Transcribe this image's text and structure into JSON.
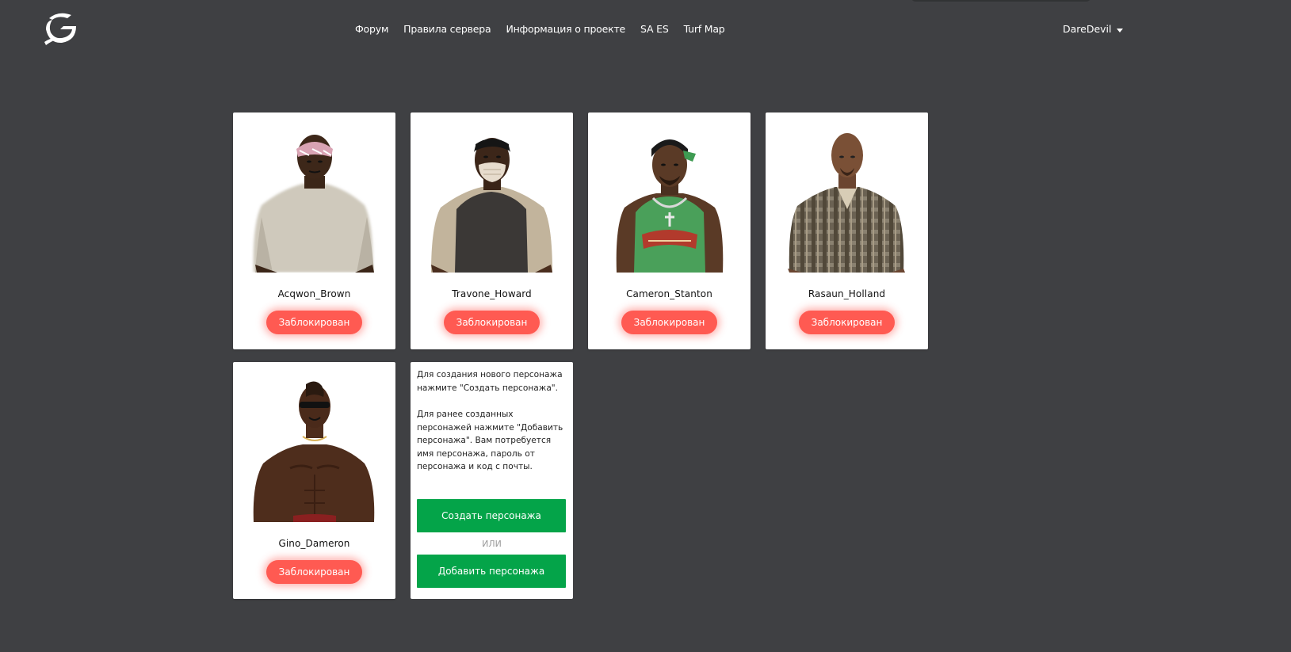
{
  "header": {
    "logo_icon": "g-logo-icon",
    "nav": [
      {
        "label": "Форум"
      },
      {
        "label": "Правила сервера"
      },
      {
        "label": "Информация о проекте"
      },
      {
        "label": "SA ES"
      },
      {
        "label": "Turf Map"
      }
    ],
    "username": "DareDevil"
  },
  "characters": [
    {
      "name": "Acqwon_Brown",
      "status": "Заблокирован",
      "skin": "white-shirt-bandana"
    },
    {
      "name": "Travone_Howard",
      "status": "Заблокирован",
      "skin": "mask-dark-vest"
    },
    {
      "name": "Cameron_Stanton",
      "status": "Заблокирован",
      "skin": "green-jersey-cap"
    },
    {
      "name": "Rasaun_Holland",
      "status": "Заблокирован",
      "skin": "plaid-shirt"
    },
    {
      "name": "Gino_Dameron",
      "status": "Заблокирован",
      "skin": "shirtless-sunglasses"
    }
  ],
  "info": {
    "text1": "Для создания нового персонажа нажмите \"Создать персонажа\".",
    "text2": "Для ранее созданных персонажей нажмите \"Добавить персонажа\". Вам потребуется имя персонажа, пароль от персонажа и код с почты.",
    "create_label": "Создать персонажа",
    "or_label": "ИЛИ",
    "add_label": "Добавить персонажа"
  },
  "colors": {
    "background": "#3f4043",
    "blocked": "#ff5a52",
    "green": "#04a449"
  }
}
